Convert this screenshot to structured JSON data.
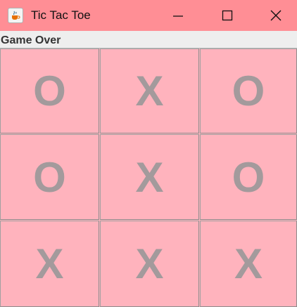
{
  "window": {
    "title": "Tic Tac Toe",
    "app_icon": "java-coffee-cup-icon",
    "controls": [
      "minimize-icon",
      "maximize-icon",
      "close-icon"
    ],
    "titlebar_color": "#ff8e95"
  },
  "status": {
    "text": "Game Over"
  },
  "board": {
    "cell_color": "#ffb3bd",
    "mark_color": "#a39a9c",
    "rows": [
      [
        "O",
        "X",
        "O"
      ],
      [
        "O",
        "X",
        "O"
      ],
      [
        "X",
        "X",
        "X"
      ]
    ]
  }
}
